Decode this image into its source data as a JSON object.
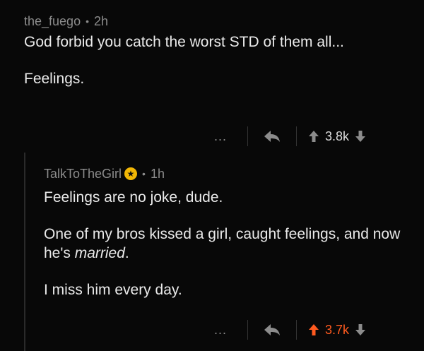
{
  "comment": {
    "author": "the_fuego",
    "separator": "•",
    "time": "2h",
    "paragraphs": [
      "God forbid you catch the worst STD of them all...",
      "Feelings."
    ],
    "actions": {
      "more": "...",
      "score": "3.8k"
    }
  },
  "reply": {
    "author": "TalkToTheGirl",
    "award_icon": "award-icon",
    "separator": "•",
    "time": "1h",
    "paragraph1": "Feelings are no joke, dude.",
    "paragraph2_start": "One of my bros kissed a girl, caught feelings, and now he's ",
    "paragraph2_em": "married",
    "paragraph2_end": ".",
    "paragraph3": "I miss him every day.",
    "actions": {
      "more": "...",
      "score": "3.7k",
      "upvoted": true
    }
  },
  "colors": {
    "background": "#080808",
    "text": "#eaeaea",
    "muted": "#8c8c8c",
    "upvote": "#ff5a1f",
    "award": "#f2b705"
  }
}
